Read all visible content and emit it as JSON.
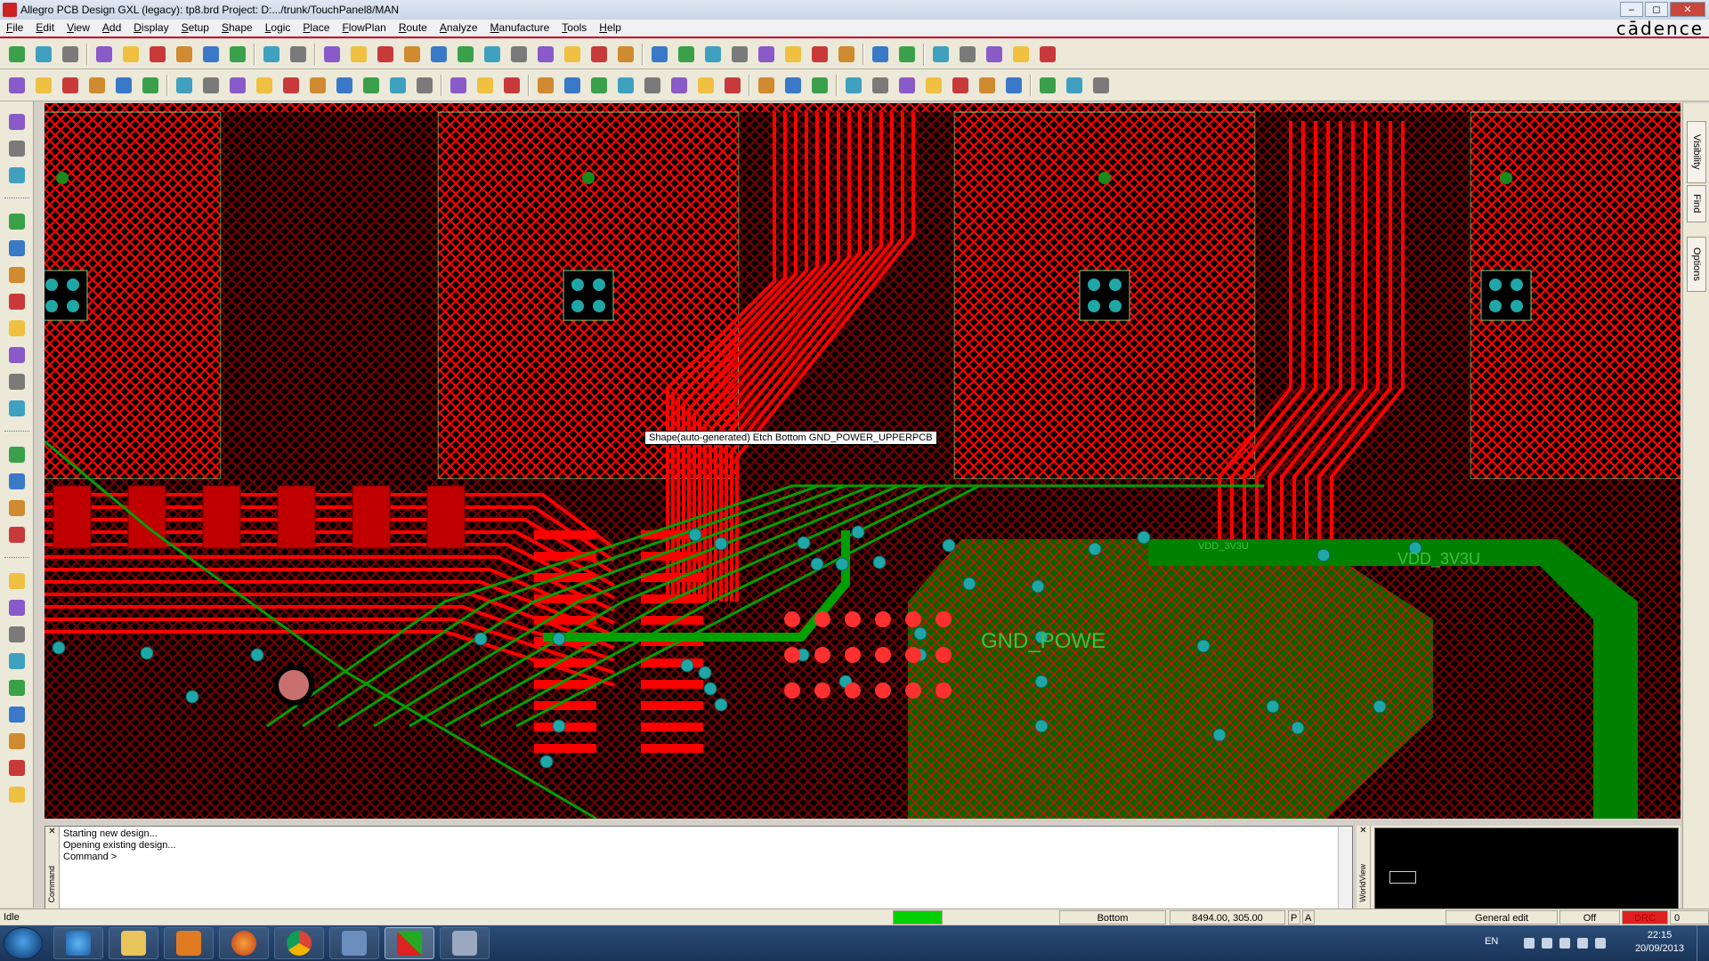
{
  "window": {
    "title": "Allegro PCB Design GXL (legacy): tp8.brd  Project: D:.../trunk/TouchPanel8/MAN",
    "brand": "cādence",
    "btn_minimize": "‒",
    "btn_maximize": "◻",
    "btn_close": "✕"
  },
  "menu": [
    "File",
    "Edit",
    "View",
    "Add",
    "Display",
    "Setup",
    "Shape",
    "Logic",
    "Place",
    "FlowPlan",
    "Route",
    "Analyze",
    "Manufacture",
    "Tools",
    "Help"
  ],
  "canvas": {
    "tooltip": "Shape(auto-generated)  Etch  Bottom  GND_POWER_UPPERPCB",
    "net_gnd": "GND_POWE",
    "net_vdd_large": "VDD_3V3U",
    "net_vdd_small": "VDD_3V3U"
  },
  "vtabs": {
    "visibility": "Visibility",
    "find": "Find",
    "options": "Options"
  },
  "command": {
    "side_label": "Command",
    "close": "✕",
    "lines": [
      "Starting new design...",
      "Opening existing design...",
      "Command >"
    ]
  },
  "worldview": {
    "side_label": "WorldView",
    "close": "✕"
  },
  "status": {
    "state": "Idle",
    "layer": "Bottom",
    "coords": "8494.00, 305.00",
    "p_btn": "P",
    "a_btn": "A",
    "mode": "General edit",
    "off": "Off",
    "drc": "DRC",
    "drc_count": "0"
  },
  "taskbar": {
    "lang": "EN",
    "time": "22:15",
    "date": "20/09/2013"
  },
  "colors": {
    "accent": "#c8102e",
    "copper_top": "#ff0000",
    "copper_bottom": "#008000",
    "via": "#1fa7a7",
    "outline": "#7ccf7c",
    "drc_red": "#e02020",
    "status_green": "#00cc00"
  }
}
